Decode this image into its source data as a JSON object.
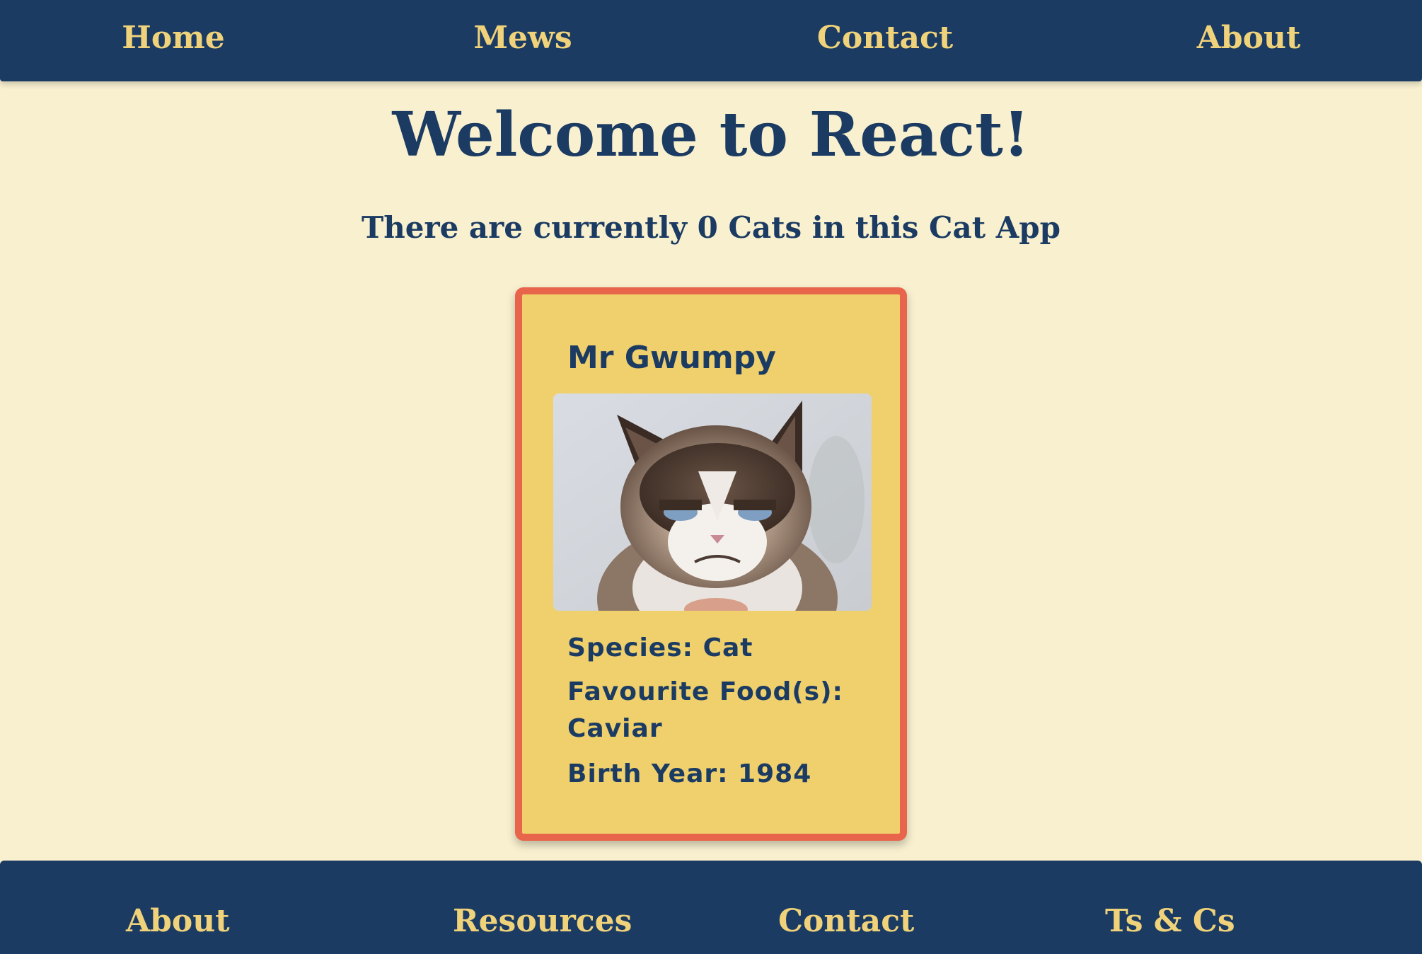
{
  "nav": {
    "items": [
      {
        "label": "Home"
      },
      {
        "label": "Mews"
      },
      {
        "label": "Contact"
      },
      {
        "label": "About"
      }
    ]
  },
  "main": {
    "title": "Welcome to React!",
    "subtitle": "There are currently 0 Cats in this Cat App"
  },
  "cat_card": {
    "name": "Mr Gwumpy",
    "species": "Species: Cat",
    "favourite_food": "Favourite Food(s): Caviar",
    "birth_year": "Birth Year: 1984",
    "image_icon": "grumpy-cat-photo"
  },
  "footer": {
    "columns": [
      {
        "heading": "About"
      },
      {
        "heading": "Resources"
      },
      {
        "heading": "Contact"
      },
      {
        "heading": "Ts & Cs"
      }
    ]
  },
  "colors": {
    "navy": "#1b3b63",
    "gold": "#efd27a",
    "background": "#f8f0cf",
    "card": "#efd06c",
    "card_border": "#e8644a"
  }
}
